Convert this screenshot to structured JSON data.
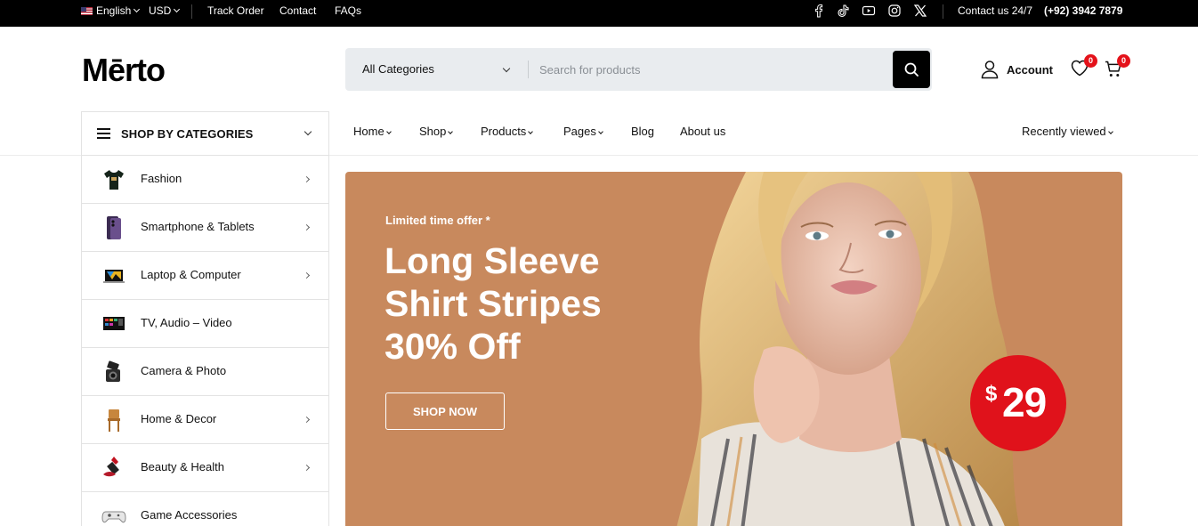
{
  "topbar": {
    "language": "English",
    "currency": "USD",
    "links": [
      "Track Order",
      "Contact",
      "FAQs"
    ],
    "social_icons": [
      "facebook-icon",
      "tiktok-icon",
      "youtube-icon",
      "instagram-icon",
      "x-icon"
    ],
    "contact_label": "Contact us 24/7",
    "phone": "(+92) 3942 7879"
  },
  "header": {
    "logo": "Mērto",
    "search": {
      "category": "All Categories",
      "placeholder": "Search for products"
    },
    "account_label": "Account",
    "wishlist_count": "0",
    "cart_count": "0"
  },
  "categories": {
    "title": "SHOP BY CATEGORIES",
    "items": [
      {
        "label": "Fashion",
        "icon": "tshirt-icon",
        "has_sub": true
      },
      {
        "label": "Smartphone & Tablets",
        "icon": "smartphone-icon",
        "has_sub": true
      },
      {
        "label": "Laptop & Computer",
        "icon": "laptop-icon",
        "has_sub": true
      },
      {
        "label": "TV, Audio – Video",
        "icon": "tv-icon",
        "has_sub": false
      },
      {
        "label": "Camera & Photo",
        "icon": "camera-icon",
        "has_sub": false
      },
      {
        "label": "Home & Decor",
        "icon": "chair-icon",
        "has_sub": true
      },
      {
        "label": "Beauty & Health",
        "icon": "lipstick-icon",
        "has_sub": true
      },
      {
        "label": "Game Accessories",
        "icon": "gamepad-icon",
        "has_sub": false
      }
    ]
  },
  "nav": {
    "items": [
      {
        "label": "Home",
        "dropdown": true
      },
      {
        "label": "Shop",
        "dropdown": true
      },
      {
        "label": "Products",
        "dropdown": true
      },
      {
        "label": "Pages",
        "dropdown": true
      },
      {
        "label": "Blog",
        "dropdown": false
      },
      {
        "label": "About us",
        "dropdown": false
      }
    ],
    "recently_viewed": "Recently viewed"
  },
  "hero": {
    "kicker": "Limited time offer *",
    "title_line1": "Long Sleeve",
    "title_line2": "Shirt Stripes",
    "title_line3": "30% Off",
    "button": "SHOP NOW",
    "price_currency": "$",
    "price_amount": "29",
    "background_color": "#c8895d",
    "badge_color": "#e0121b"
  }
}
